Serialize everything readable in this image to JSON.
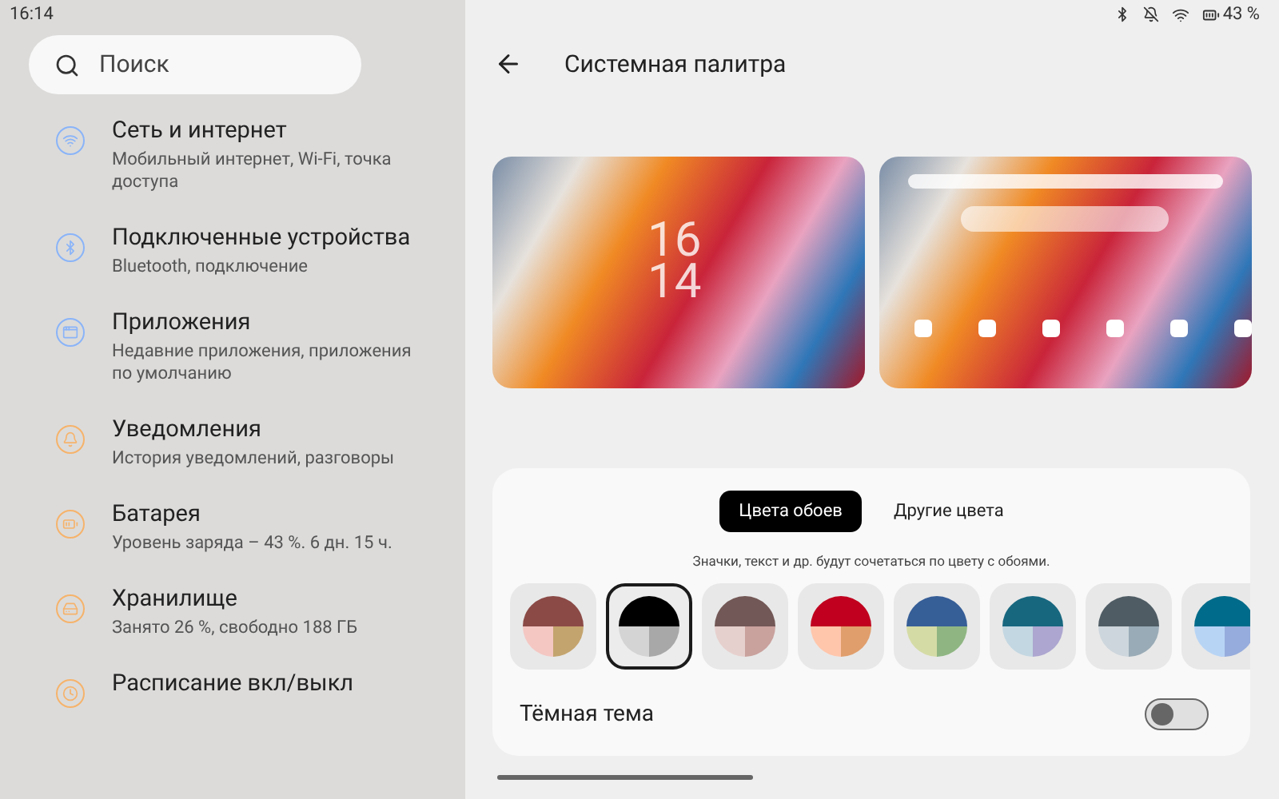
{
  "status_bar": {
    "time": "16:14",
    "battery": "43 %"
  },
  "search": {
    "placeholder": "Поиск"
  },
  "sidebar": {
    "items": [
      {
        "title": "Сеть и интернет",
        "subtitle": "Мобильный интернет, Wi-Fi, точка доступа",
        "color": "#8ab4f8",
        "kind": "network"
      },
      {
        "title": "Подключенные устройства",
        "subtitle": "Bluetooth, подключение",
        "color": "#8ab4f8",
        "kind": "bluetooth"
      },
      {
        "title": "Приложения",
        "subtitle": "Недавние приложения, приложения по умолчанию",
        "color": "#8ab4f8",
        "kind": "apps"
      },
      {
        "title": "Уведомления",
        "subtitle": "История уведомлений, разговоры",
        "color": "#f6b36b",
        "kind": "bell"
      },
      {
        "title": "Батарея",
        "subtitle": "Уровень заряда – 43 %. 6 дн. 15 ч.",
        "color": "#f6b36b",
        "kind": "battery"
      },
      {
        "title": "Хранилище",
        "subtitle": "Занято 26 %, свободно 188 ГБ",
        "color": "#f6b36b",
        "kind": "storage"
      },
      {
        "title": "Расписание вкл/выкл",
        "kind": "schedule",
        "color": "#f6b36b"
      }
    ]
  },
  "page": {
    "title": "Системная палитра"
  },
  "lock_preview": {
    "hours": "16",
    "minutes": "14"
  },
  "tabs": [
    {
      "label": "Цвета обоев",
      "selected": true
    },
    {
      "label": "Другие цвета",
      "selected": false
    }
  ],
  "hint": "Значки, текст и др. будут сочетаться по цвету с обоями.",
  "swatches": [
    {
      "segments": [
        {
          "color": "#8b4a46"
        },
        {
          "color": "#f4c7c3"
        },
        {
          "color": "#c4a46e"
        }
      ],
      "selected": false
    },
    {
      "segments": [
        {
          "color": "#000000"
        },
        {
          "color": "#d4d4d4"
        },
        {
          "color": "#a8a8a8"
        }
      ],
      "selected": true
    },
    {
      "segments": [
        {
          "color": "#725856"
        },
        {
          "color": "#e6d0ce"
        },
        {
          "color": "#c9a19d"
        }
      ],
      "selected": false
    },
    {
      "segments": [
        {
          "color": "#c0001e"
        },
        {
          "color": "#ffc6ac"
        },
        {
          "color": "#e09e6c"
        }
      ],
      "selected": false
    },
    {
      "segments": [
        {
          "color": "#365e97"
        },
        {
          "color": "#d5dba5"
        },
        {
          "color": "#8fb682"
        }
      ],
      "selected": false
    },
    {
      "segments": [
        {
          "color": "#17677f"
        },
        {
          "color": "#c3d7e2"
        },
        {
          "color": "#aca6d0"
        }
      ],
      "selected": false
    },
    {
      "segments": [
        {
          "color": "#4f5c64"
        },
        {
          "color": "#cdd6dc"
        },
        {
          "color": "#99abb6"
        }
      ],
      "selected": false
    },
    {
      "segments": [
        {
          "color": "#006b8a"
        },
        {
          "color": "#b8d4f5"
        },
        {
          "color": "#96acdc"
        }
      ],
      "selected": false
    }
  ],
  "dark_theme": {
    "label": "Тёмная тема",
    "on": false
  }
}
